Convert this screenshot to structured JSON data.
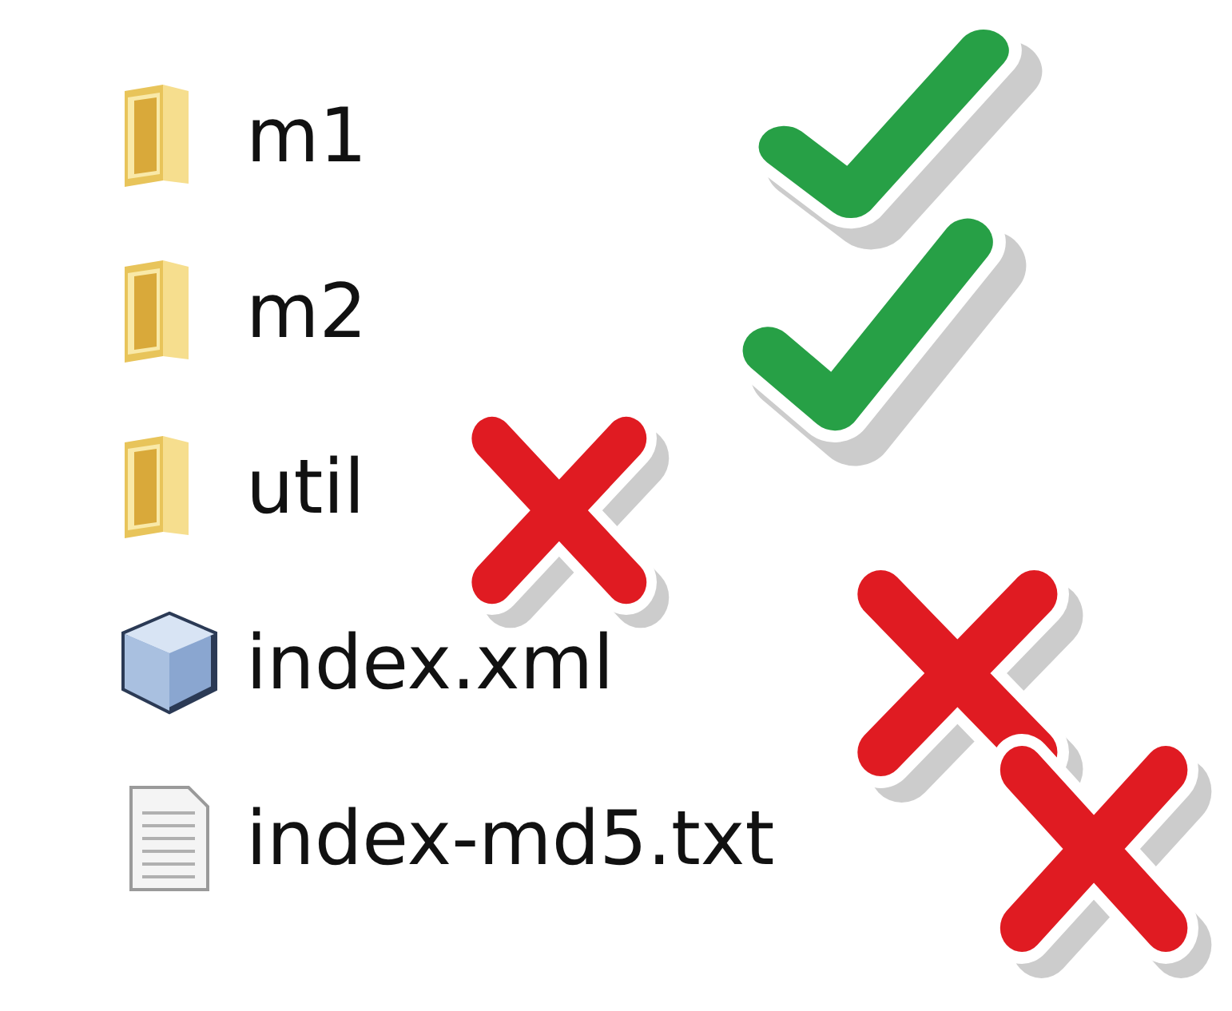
{
  "files": [
    {
      "name": "m1",
      "kind": "folder",
      "checked": true
    },
    {
      "name": "m2",
      "kind": "folder",
      "checked": true
    },
    {
      "name": "util",
      "kind": "folder",
      "checked": false
    },
    {
      "name": "index.xml",
      "kind": "xml",
      "checked": false
    },
    {
      "name": "index-md5.txt",
      "kind": "text",
      "checked": false
    }
  ]
}
